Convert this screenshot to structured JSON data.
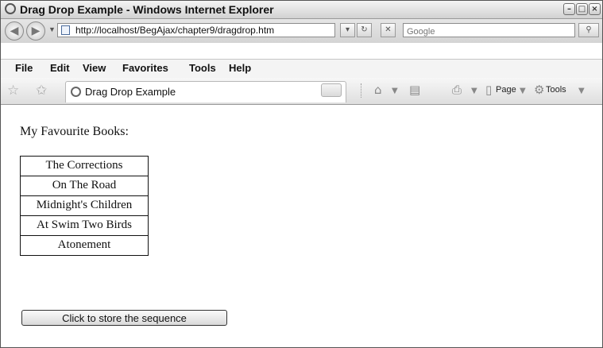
{
  "window": {
    "title": "Drag Drop Example - Windows Internet Explorer",
    "controls": {
      "minimize": "–",
      "maximize": "□",
      "close": "×"
    }
  },
  "address_bar": {
    "url": "http://localhost/BegAjax/chapter9/dragdrop.htm",
    "search_placeholder": "Google"
  },
  "menu": {
    "items": [
      {
        "label": "File"
      },
      {
        "label": "Edit"
      },
      {
        "label": "View"
      },
      {
        "label": "Favorites"
      },
      {
        "label": "Tools"
      },
      {
        "label": "Help"
      }
    ]
  },
  "command_bar": {
    "tab_label": "Drag Drop Example",
    "page_label": "Page",
    "tools_label": "Tools"
  },
  "icons": {
    "back": "back-arrow-icon",
    "forward": "forward-arrow-icon",
    "home": "home-icon",
    "print": "print-icon",
    "feeds": "feeds-icon",
    "refresh": "refresh-icon",
    "stop": "stop-icon",
    "search": "search-icon"
  },
  "page": {
    "heading": "My Favourite Books:",
    "books": [
      {
        "title": "The Corrections"
      },
      {
        "title": "On The Road"
      },
      {
        "title": "Midnight's Children"
      },
      {
        "title": "At Swim Two Birds"
      },
      {
        "title": "Atonement"
      }
    ],
    "store_button_label": "Click to store the sequence"
  }
}
